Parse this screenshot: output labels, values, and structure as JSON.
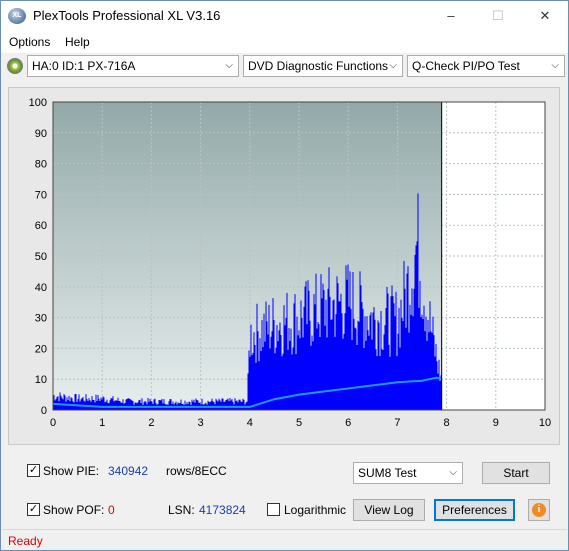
{
  "window": {
    "title": "PlexTools Professional XL V3.16",
    "app_icon_text": "XL"
  },
  "menu": {
    "options": "Options",
    "help": "Help"
  },
  "toolbar": {
    "drive": "HA:0 ID:1  PX-716A",
    "function": "DVD Diagnostic Functions",
    "test": "Q-Check PI/PO Test"
  },
  "chart_data": {
    "type": "bar",
    "x_range": [
      0,
      10
    ],
    "y_range": [
      0,
      100
    ],
    "x_ticks": [
      "0",
      "1",
      "2",
      "3",
      "4",
      "5",
      "6",
      "7",
      "8",
      "9",
      "10"
    ],
    "y_ticks": [
      "0",
      "10",
      "20",
      "30",
      "40",
      "50",
      "60",
      "70",
      "80",
      "90",
      "100"
    ],
    "grid": true,
    "end_marker_x": 7.9,
    "series": [
      {
        "color": "#0000ff",
        "x": [
          0.0,
          0.5,
          1.0,
          1.5,
          2.0,
          2.5,
          3.0,
          3.5,
          3.95,
          4.0,
          4.5,
          5.0,
          5.5,
          6.0,
          6.5,
          7.0,
          7.2,
          7.4,
          7.6,
          7.8,
          7.9
        ],
        "values": [
          5,
          4,
          4,
          3,
          3,
          3,
          3,
          3,
          3,
          26,
          30,
          32,
          36,
          38,
          32,
          31,
          42,
          58,
          36,
          18,
          10
        ]
      },
      {
        "color": "#1e9be8",
        "x": [
          0.0,
          1.0,
          2.0,
          3.0,
          3.95,
          4.0,
          4.5,
          5.0,
          5.5,
          6.0,
          6.5,
          7.0,
          7.5,
          7.8,
          7.9
        ],
        "values": [
          2,
          1,
          1,
          1,
          1,
          1,
          3.5,
          5,
          6,
          7,
          8,
          9,
          9.5,
          10.5,
          10
        ]
      }
    ],
    "colors": {
      "plot_bg_top": "#93a9a9",
      "plot_bg_bottom": "#e8eeee",
      "pie_bars": "#0000ff",
      "pof_line": "#1e9be8"
    }
  },
  "stats": {
    "show_pie_label": "Show PIE:",
    "pie_value": "340942",
    "rows_label": "rows/8ECC",
    "show_pof_label": "Show POF:",
    "pof_value": "0",
    "lsn_label": "LSN:",
    "lsn_value": "4173824",
    "logarithmic_label": "Logarithmic",
    "test_select": "SUM8 Test"
  },
  "buttons": {
    "start": "Start",
    "view_log": "View Log",
    "preferences": "Preferences"
  },
  "status": {
    "text": "Ready"
  }
}
